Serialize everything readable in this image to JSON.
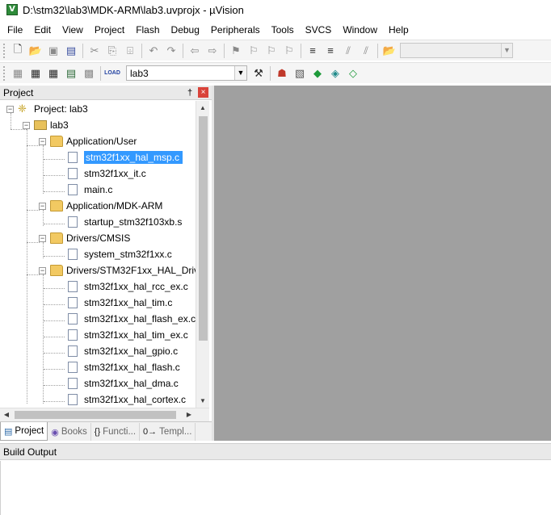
{
  "window": {
    "title": "D:\\stm32\\lab3\\MDK-ARM\\lab3.uvprojx - µVision"
  },
  "menu": [
    "File",
    "Edit",
    "View",
    "Project",
    "Flash",
    "Debug",
    "Peripherals",
    "Tools",
    "SVCS",
    "Window",
    "Help"
  ],
  "toolbar2": {
    "load_label": "LOAD",
    "target": "lab3"
  },
  "project_panel": {
    "title": "Project",
    "pin_glyph": "†",
    "close_glyph": "×",
    "root": "Project: lab3",
    "target": "lab3",
    "groups": [
      {
        "name": "Application/User",
        "files": [
          "stm32f1xx_hal_msp.c",
          "stm32f1xx_it.c",
          "main.c"
        ]
      },
      {
        "name": "Application/MDK-ARM",
        "files": [
          "startup_stm32f103xb.s"
        ]
      },
      {
        "name": "Drivers/CMSIS",
        "files": [
          "system_stm32f1xx.c"
        ]
      },
      {
        "name": "Drivers/STM32F1xx_HAL_Driv",
        "files": [
          "stm32f1xx_hal_rcc_ex.c",
          "stm32f1xx_hal_tim.c",
          "stm32f1xx_hal_flash_ex.c",
          "stm32f1xx_hal_tim_ex.c",
          "stm32f1xx_hal_gpio.c",
          "stm32f1xx_hal_flash.c",
          "stm32f1xx_hal_dma.c",
          "stm32f1xx_hal_cortex.c"
        ]
      }
    ],
    "selected_file": "stm32f1xx_hal_msp.c"
  },
  "panel_tabs": [
    {
      "label": "Project",
      "icon": "project-tab-icon"
    },
    {
      "label": "Books",
      "icon": "books-icon"
    },
    {
      "label": "Functi...",
      "icon": "functions-icon"
    },
    {
      "label": "Templ...",
      "icon": "templates-icon"
    }
  ],
  "build_output": {
    "title": "Build Output"
  },
  "colors": {
    "selection": "#3399ff",
    "editor_bg": "#a0a0a0",
    "folder": "#f2c962"
  }
}
